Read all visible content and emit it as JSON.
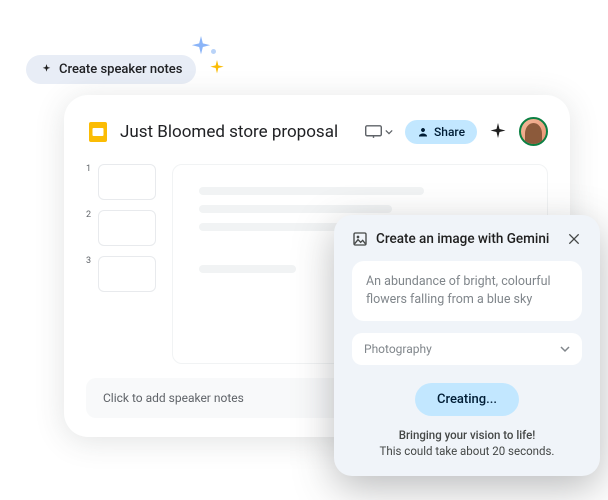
{
  "chip": {
    "label": "Create speaker notes"
  },
  "slides": {
    "title": "Just Bloomed store proposal",
    "share_label": "Share",
    "footer_note": "Click to add speaker notes",
    "thumbs": [
      "1",
      "2",
      "3"
    ]
  },
  "gemini": {
    "title": "Create an image with Gemini",
    "prompt": "An abundance of bright, colourful flowers falling from a blue sky",
    "style": "Photography",
    "button": "Creating...",
    "status1": "Bringing your vision to life!",
    "status2": "This could take about 20 seconds."
  }
}
